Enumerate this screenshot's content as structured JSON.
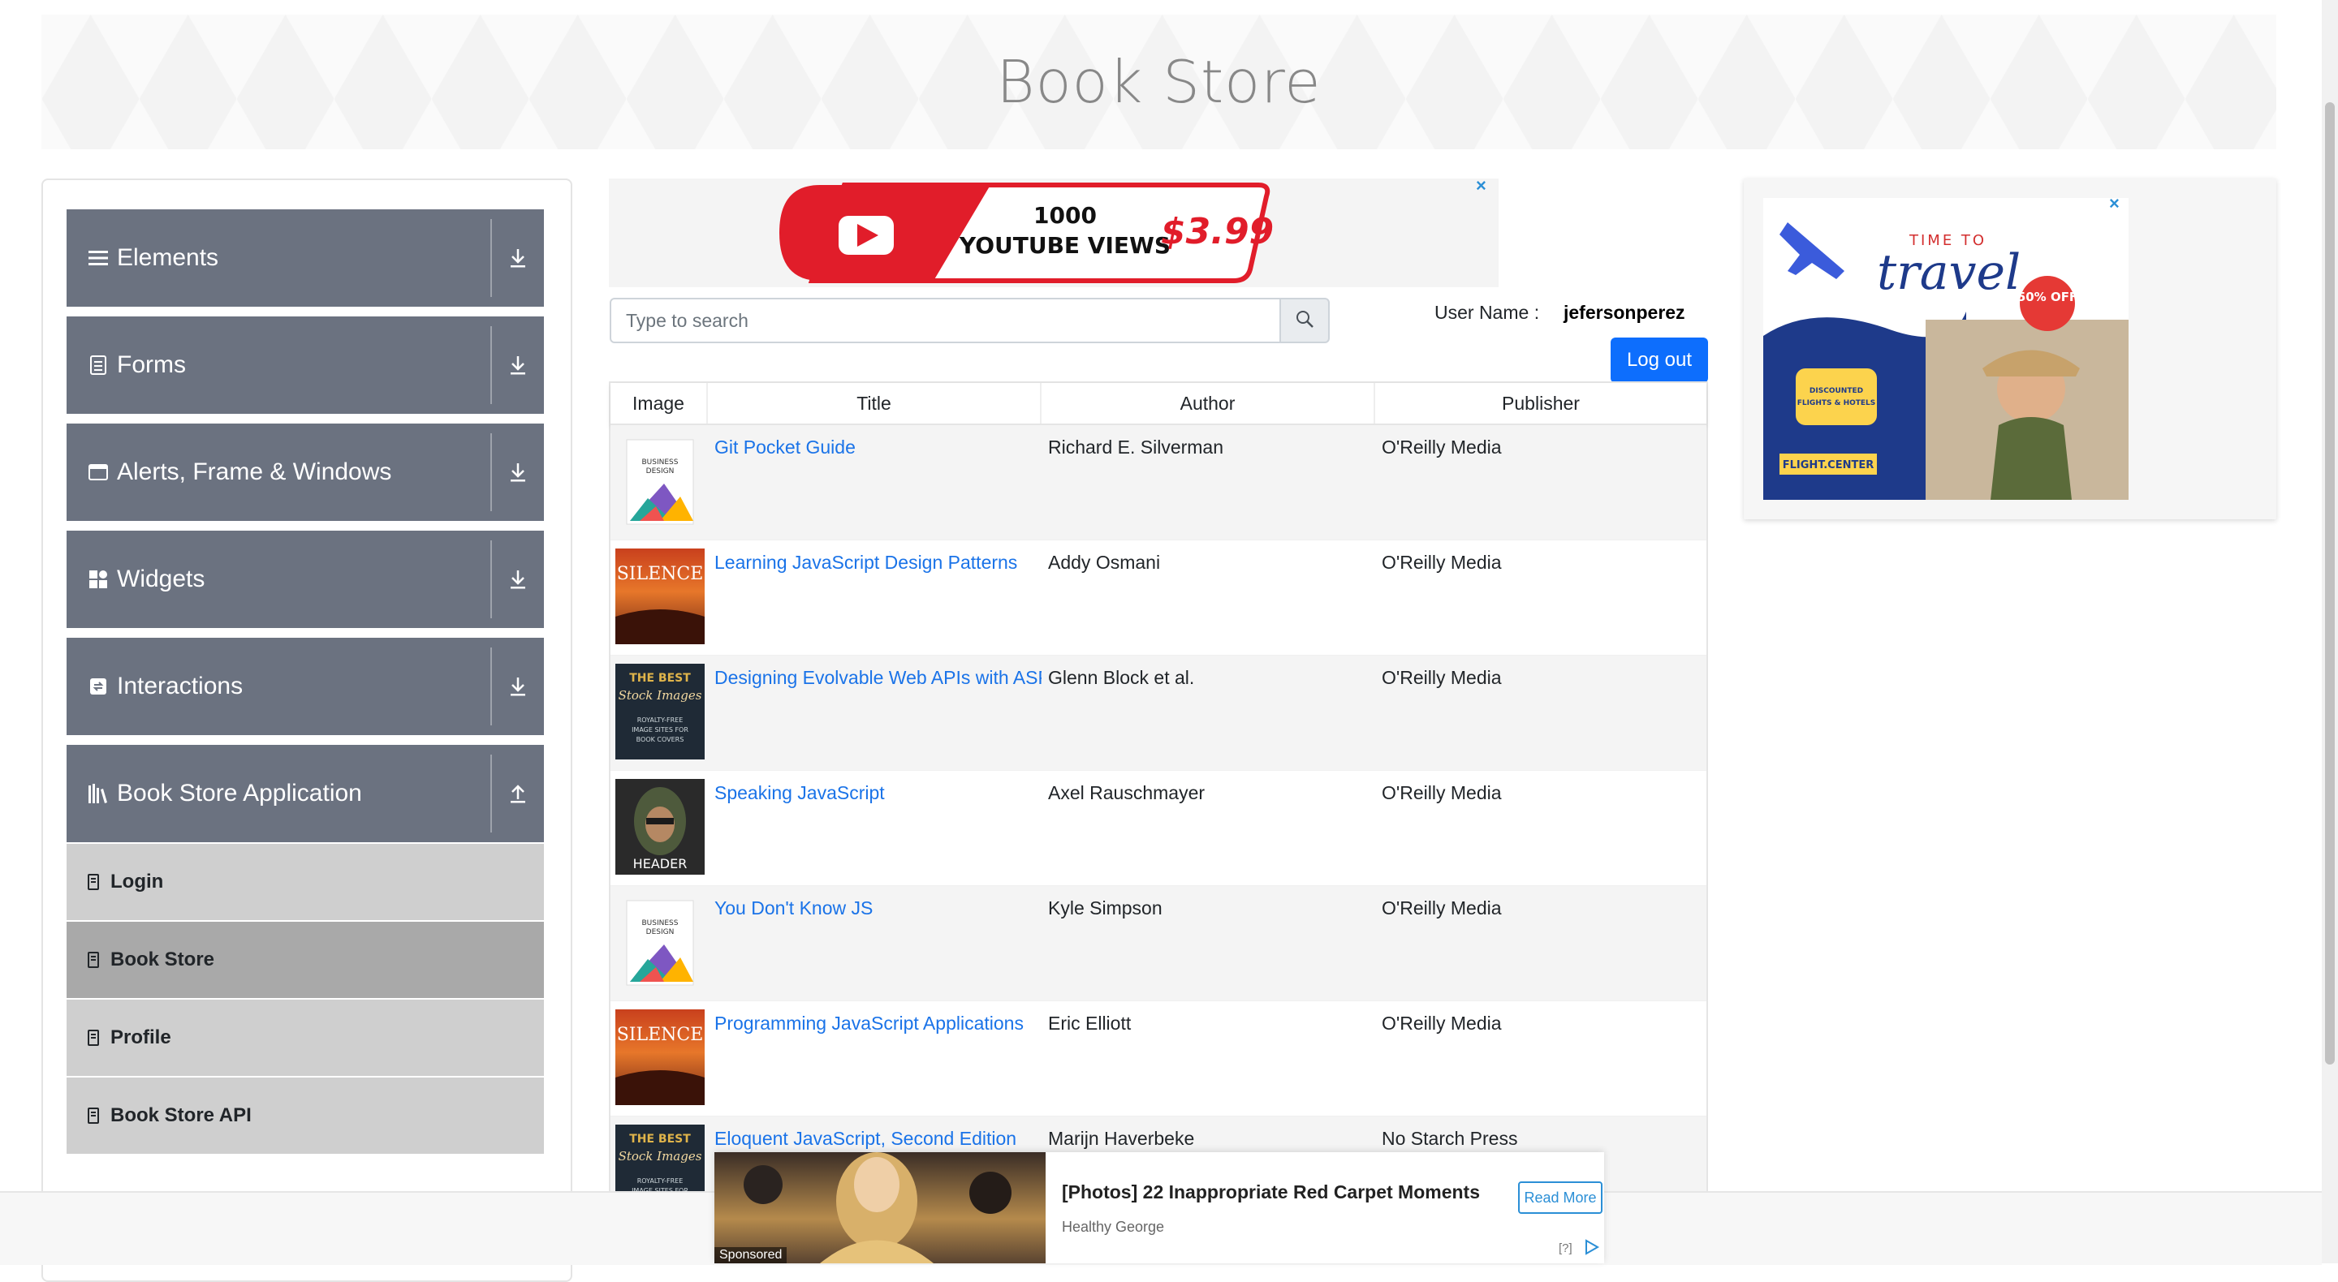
{
  "header": {
    "title": "Book Store"
  },
  "sidebar": {
    "groups": [
      {
        "label": "Elements",
        "icon": "hamburger-icon",
        "arrow": "download-arrow-icon"
      },
      {
        "label": "Forms",
        "icon": "form-icon",
        "arrow": "download-arrow-icon"
      },
      {
        "label": "Alerts, Frame & Windows",
        "icon": "window-icon",
        "arrow": "download-arrow-icon"
      },
      {
        "label": "Widgets",
        "icon": "widgets-icon",
        "arrow": "download-arrow-icon"
      },
      {
        "label": "Interactions",
        "icon": "interactions-icon",
        "arrow": "download-arrow-icon"
      },
      {
        "label": "Book Store Application",
        "icon": "library-icon",
        "arrow": "upload-arrow-icon"
      }
    ],
    "subitems": [
      {
        "label": "Login",
        "active": false
      },
      {
        "label": "Book Store",
        "active": true
      },
      {
        "label": "Profile",
        "active": false
      },
      {
        "label": "Book Store API",
        "active": false
      }
    ]
  },
  "search": {
    "placeholder": "Type to search"
  },
  "user": {
    "label": "User Name :",
    "value": "jefersonperez",
    "logout": "Log out"
  },
  "table": {
    "headers": [
      "Image",
      "Title",
      "Author",
      "Publisher"
    ],
    "rows": [
      {
        "cover": "design",
        "title": "Git Pocket Guide",
        "author": "Richard E. Silverman",
        "publisher": "O'Reilly Media"
      },
      {
        "cover": "silence",
        "title": "Learning JavaScript Design Patterns",
        "author": "Addy Osmani",
        "publisher": "O'Reilly Media"
      },
      {
        "cover": "stock",
        "title": "Designing Evolvable Web APIs with ASP.NET",
        "author": "Glenn Block et al.",
        "publisher": "O'Reilly Media"
      },
      {
        "cover": "header",
        "title": "Speaking JavaScript",
        "author": "Axel Rauschmayer",
        "publisher": "O'Reilly Media"
      },
      {
        "cover": "design",
        "title": "You Don't Know JS",
        "author": "Kyle Simpson",
        "publisher": "O'Reilly Media"
      },
      {
        "cover": "silence",
        "title": "Programming JavaScript Applications",
        "author": "Eric Elliott",
        "publisher": "O'Reilly Media"
      },
      {
        "cover": "stock",
        "title": "Eloquent JavaScript, Second Edition",
        "author": "Marijn Haverbeke",
        "publisher": "No Starch Press"
      }
    ]
  },
  "ads": {
    "top": {
      "line1": "1000",
      "line2": "YOUTUBE VIEWS",
      "price": "$3.99"
    },
    "right": {
      "kicker": "TIME TO",
      "headline": "travel",
      "discount": "50% OFF",
      "badge": "DISCOUNTED FLIGHTS & HOTELS",
      "brand": "FLIGHT.CENTER"
    },
    "bottom": {
      "title": "[Photos] 22 Inappropriate Red Carpet Moments",
      "source": "Healthy George",
      "button": "Read More",
      "sponsored": "Sponsored",
      "info": "[?]"
    },
    "close": "×"
  },
  "covers": {
    "design": {
      "l1": "BUSINESS",
      "l2": "DESIGN"
    },
    "silence": {
      "text": "SILENCE"
    },
    "stock": {
      "l1": "THE BEST",
      "l2": "Stock Images",
      "l3": "ROYALTY-FREE",
      "l4": "IMAGE SITES FOR",
      "l5": "BOOK COVERS"
    },
    "header": {
      "text": "HEADER"
    }
  }
}
